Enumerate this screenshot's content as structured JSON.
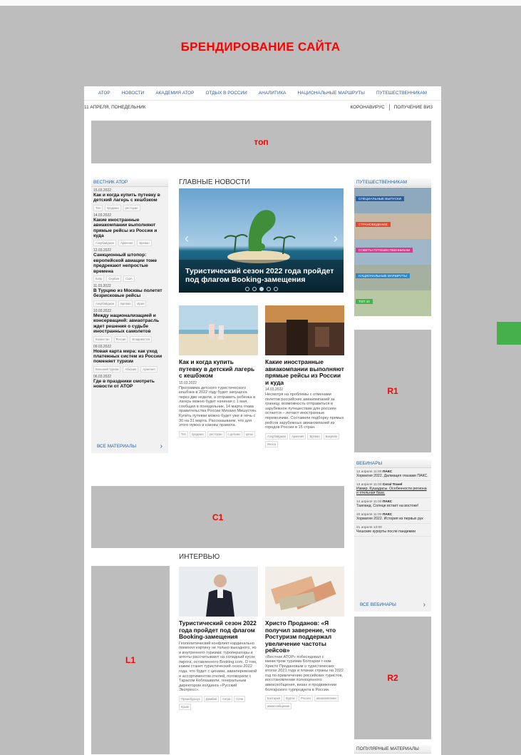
{
  "branding_title": "БРЕНДИРОВАНИЕ САЙТА",
  "nav": [
    "АТОР",
    "НОВОСТИ",
    "АКАДЕМИЯ АТОР",
    "ОТДЫХ В РОССИИ",
    "АНАЛИТИКА",
    "НАЦИОНАЛЬНЫЕ МАРШРУТЫ",
    "ПУТЕШЕСТВЕННИКАМ"
  ],
  "subbar": {
    "date": "11 АПРЕЛЯ, ПОНЕДЕЛЬНИК",
    "link1": "КОРОНАВИРУС",
    "link2": "ПОЛУЧЕНИЕ ВИЗ"
  },
  "ads": {
    "top": "топ",
    "c1": "C1",
    "r1": "R1",
    "r2": "R2",
    "l1": "L1"
  },
  "left_col": {
    "header": "ВЕСТНИК АТОР",
    "items": [
      {
        "date": "15.03.2022",
        "title": "Как и когда купить путевку в детский лагерь с кешбэком",
        "tags": [
          "Топ",
          "продажи",
          "ресторан"
        ]
      },
      {
        "date": "14.03.2022",
        "title": "Какие иностранные авиакомпании выполняют прямые рейсы из России и куда",
        "tags": [
          "Азербайджан",
          "Армения",
          "Бреван"
        ]
      },
      {
        "date": "12.03.2022",
        "title": "Санкционный штопор: европейской авиации тоже предрекают непростые времена",
        "tags": [
          "Кипр",
          "Сербия",
          "США"
        ]
      },
      {
        "date": "11.03.2022",
        "title": "В Турцию из Москвы полетят безрисковые рейсы",
        "tags": [
          "Азербайджан",
          "Бреван",
          "Иран"
        ]
      },
      {
        "date": "10.03.2022",
        "title": "Между национализацией и консервацией: авиаотрасль ждет решения о судьбе иностранных самолетов",
        "tags": [
          "Казахстан",
          "Россия",
          "Владивосток"
        ]
      },
      {
        "date": "09.03.2022",
        "title": "Новая карта мира: как уход платежных систем из России поменяет туризм",
        "tags": [
          "Внешний туризм",
          "Абхазия",
          "Армения"
        ]
      },
      {
        "date": "06.03.2022",
        "title": "Где в праздники смотреть новости от АТОР",
        "tags": []
      }
    ],
    "all_label": "ВСЕ МАТЕРИАЛЫ"
  },
  "main": {
    "header": "ГЛАВНЫЕ НОВОСТИ",
    "slider_caption": "Туристический сезон 2022 года пройдет под флагом Booking-замещения",
    "cards": [
      {
        "title": "Как и когда купить путевку в детский лагерь с кешбэком",
        "date": "15.03.2022",
        "text": "Программа детского туристического кешбэка в 2022 году будет запущена через две недели, а отправить ребенка в лагерь можно будет начиная с 1 мая, сообщил в понедельник, 14 марта глава правительства России Михаил Мишустин. Купить путевки можно будет уже в ночь с 30 на 31 марта. Рассказываем, что для этого нужно и каковы правила.",
        "tags": [
          "Топ",
          "продажи",
          "ресторан",
          "с детьми",
          "цены"
        ]
      },
      {
        "title": "Какие иностранные авиакомпании выполняют прямые рейсы из России и куда",
        "date": "14.03.2022",
        "text": "Несмотря на проблемы с отменами полетов российских авиакомпаний за границу, возможность отправиться в зарубежное путешествие для россиян остается – летают иностранные перевозчики. Составили подборку прямых рейсов зарубежных авиакомпаний из городов России в 15 стран.",
        "tags": [
          "Азербайджан",
          "Армения",
          "Бреван",
          "Бахрейн",
          "Иноса"
        ]
      }
    ]
  },
  "right_col": {
    "header": "ПУТЕШЕСТВЕННИКАМ",
    "tiles": [
      {
        "label": "СПЕЦИАЛЬНЫЕ ВЫПУСКИ",
        "color": "#2a5e9e"
      },
      {
        "label": "СТРАНОВЕДЕНИЕ",
        "color": "#e04a2f"
      },
      {
        "label": "СОВЕТЫ ПУТЕШЕСТВЕННИКАМ",
        "color": "#d63b8a"
      },
      {
        "label": "НАЦИОНАЛЬНЫЕ МАРШРУТЫ",
        "color": "#2e87c8"
      },
      {
        "label": "ТОП 10",
        "color": "#46b04a"
      }
    ]
  },
  "webinars": {
    "header": "ВЕБИНАРЫ",
    "items": [
      {
        "date": "12 апреля 11:00",
        "org": "ПАКС",
        "title": "Хорватия 2022. Далмация глазами ПАКС."
      },
      {
        "date": "13 апреля 11:00",
        "org": "Coral Travel",
        "title": "Измир, Кушадасы. Особенности региона и отельная база."
      },
      {
        "date": "14 апреля 11:00",
        "org": "ПАКС",
        "title": "Таиланд. Солнце встает на востоке!"
      },
      {
        "date": "20 апреля 11:00",
        "org": "ПАКС",
        "title": "Хорватия 2022. История из первых рук"
      },
      {
        "date": "21 апреля 13:00",
        "org": "",
        "title": "Чешские курорты после пандемии"
      }
    ],
    "all_label": "ВСЕ ВЕБИНАРЫ"
  },
  "interviews": {
    "header": "ИНТЕРВЬЮ",
    "cards": [
      {
        "title": "Туристический сезон 2022 года пройдет под флагом Booking-замещения",
        "text": "Геополитический конфликт кардинально поменял картину не только выездного, но и внутреннего туризма: туроператоры и агенты рассчитывают на солидный кусок пирога, оставленного Booking.com. О том, каким станет туристический сезон 2022 года, что будет с ценами, авиаперевозкой и ассортиментом отелей, поговорили с Тарасом Коблашвили, генеральным директором холдинга «Русский Экспресс».",
        "tags": [
          "Премьбуршус",
          "Домбай",
          "Ангра",
          "Сочи",
          "Крым"
        ]
      },
      {
        "title": "Христо Проданов: «Я получил заверение, что Ростуризм поддержал увеличение частоты рейсов»",
        "text": "«Вестник АТОР» побеседовал с министром туризма Болгарии г-ном Христо Продановым о туристических итогах 2021 года и планах страны на 2022 год по привлечению российских туристов, восстановлении полноценного авиасообщения, визах и продвижении болгарского турпродукта в России.",
        "tags": [
          "Болгария",
          "Бургас",
          "Россия",
          "авиакомпании",
          "авиасообщение"
        ]
      }
    ]
  },
  "popular_header": "ПОПУЛЯРНЫЕ МАТЕРИАЛЫ"
}
